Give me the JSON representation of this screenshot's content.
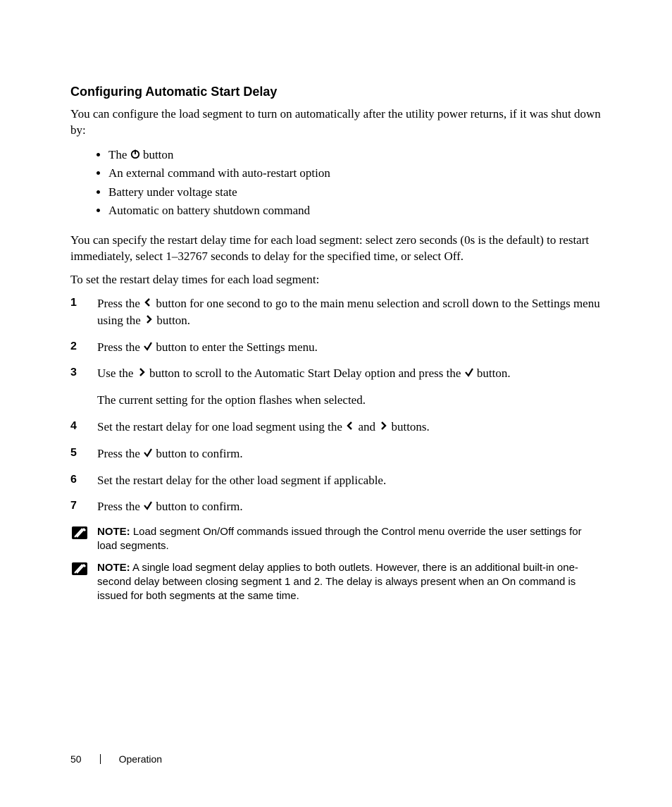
{
  "heading": "Configuring Automatic Start Delay",
  "intro": "You can configure the load segment to turn on automatically after the utility power returns, if it was shut down by:",
  "bullets": {
    "b1_pre": "The ",
    "b1_post": " button",
    "b2": "An external command with auto-restart option",
    "b3": "Battery under voltage state",
    "b4": "Automatic on battery shutdown command"
  },
  "para_restart": "You can specify the restart delay time for each load segment: select zero seconds (0s is the default) to restart immediately, select 1–32767 seconds to delay for the specified time, or select Off.",
  "para_toset": "To set the restart delay times for each load segment:",
  "steps": {
    "s1_pre": "Press the ",
    "s1_mid": " button for one second to go to the main menu selection and scroll down to the Settings menu using the ",
    "s1_post": " button.",
    "s2_pre": "Press the ",
    "s2_post": " button to enter the Settings menu.",
    "s3_pre": "Use the ",
    "s3_mid": " button to scroll to the Automatic Start Delay option and press the ",
    "s3_post": " button.",
    "s3_sub": "The current setting for the option flashes when selected.",
    "s4_pre": "Set the restart delay for one load segment using the ",
    "s4_mid": " and ",
    "s4_post": " buttons.",
    "s5_pre": "Press the ",
    "s5_post": " button to confirm.",
    "s6": "Set the restart delay for the other load segment if applicable.",
    "s7_pre": "Press the ",
    "s7_post": " button to confirm."
  },
  "notes": {
    "label": "NOTE:",
    "n1": " Load segment On/Off commands issued through the Control menu override the user settings for load segments.",
    "n2": " A single load segment delay applies to both outlets. However, there is an additional built-in one-second delay between closing segment 1 and 2. The delay is always present when an On command is issued for both segments at the same time."
  },
  "footer": {
    "page": "50",
    "section": "Operation"
  }
}
